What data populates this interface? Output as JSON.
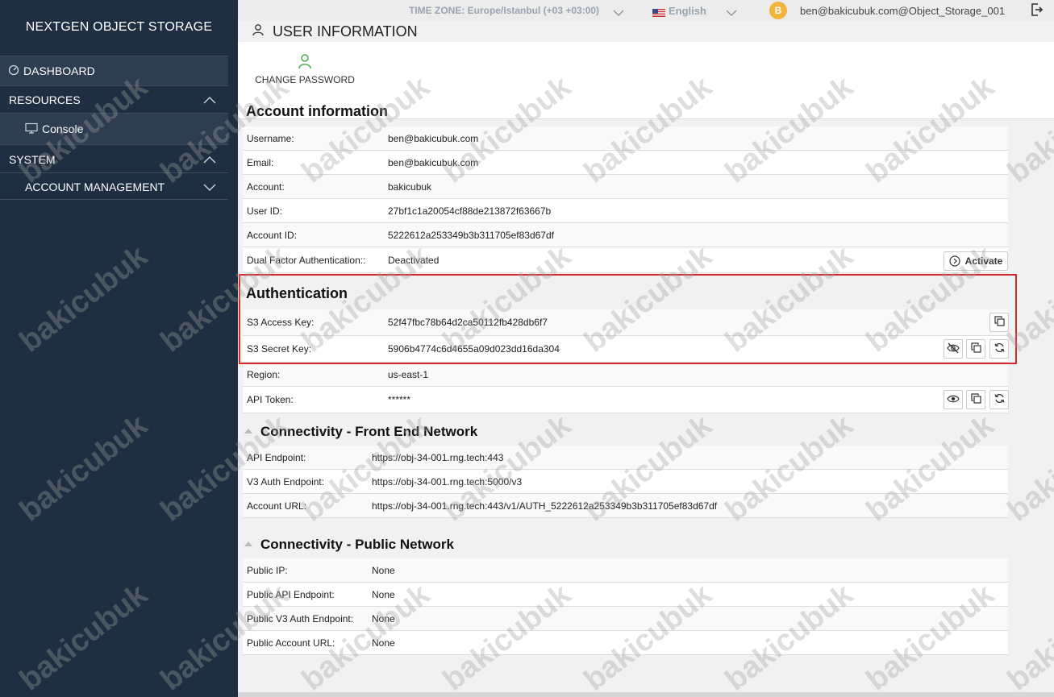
{
  "sidebar": {
    "brand": "NEXTGEN OBJECT STORAGE",
    "dashboard": "DASHBOARD",
    "resources": "RESOURCES",
    "console": "Console",
    "system": "SYSTEM",
    "account_management": "ACCOUNT MANAGEMENT"
  },
  "topbar": {
    "timezone": "TIME ZONE: Europe/Istanbul (+03 +03:00)",
    "language": "English",
    "avatar_letter": "B",
    "user": "ben@bakicubuk.com@Object_Storage_001"
  },
  "page": {
    "title": "USER INFORMATION",
    "change_password": "CHANGE PASSWORD"
  },
  "account_info": {
    "title": "Account information",
    "rows": [
      {
        "label": "Username:",
        "value": "ben@bakicubuk.com"
      },
      {
        "label": "Email:",
        "value": "ben@bakicubuk.com"
      },
      {
        "label": "Account:",
        "value": "bakicubuk"
      },
      {
        "label": "User ID:",
        "value": "27bf1c1a20054cf88de213872f63667b"
      },
      {
        "label": "Account ID:",
        "value": "5222612a253349b3b311705ef83d67df"
      },
      {
        "label": "Dual Factor Authentication::",
        "value": "Deactivated"
      }
    ],
    "activate_label": "Activate"
  },
  "authentication": {
    "title": "Authentication",
    "rows": [
      {
        "label": "S3 Access Key:",
        "value": "52f47fbc78b64d2ca50112fb428db6f7"
      },
      {
        "label": "S3 Secret Key:",
        "value": "5906b4774c6d4655a09d023dd16da304"
      },
      {
        "label": "Region:",
        "value": "us-east-1"
      },
      {
        "label": "API Token:",
        "value": "******"
      }
    ]
  },
  "front_end": {
    "title": "Connectivity - Front End Network",
    "rows": [
      {
        "label": "API Endpoint:",
        "value": "https://obj-34-001.rng.tech:443"
      },
      {
        "label": "V3 Auth Endpoint:",
        "value": "https://obj-34-001.rng.tech:5000/v3"
      },
      {
        "label": "Account URL:",
        "value": "https://obj-34-001.rng.tech:443/v1/AUTH_5222612a253349b3b311705ef83d67df"
      }
    ]
  },
  "public": {
    "title": "Connectivity - Public Network",
    "rows": [
      {
        "label": "Public IP:",
        "value": "None"
      },
      {
        "label": "Public API Endpoint:",
        "value": "None"
      },
      {
        "label": "Public V3 Auth Endpoint:",
        "value": "None"
      },
      {
        "label": "Public Account URL:",
        "value": "None"
      }
    ]
  },
  "watermark": "bakicubuk",
  "colors": {
    "sidebar_bg": "#1f2e40",
    "highlight": "#d42a2a",
    "avatar": "#f2b43a",
    "accent_green": "#4caf50"
  }
}
